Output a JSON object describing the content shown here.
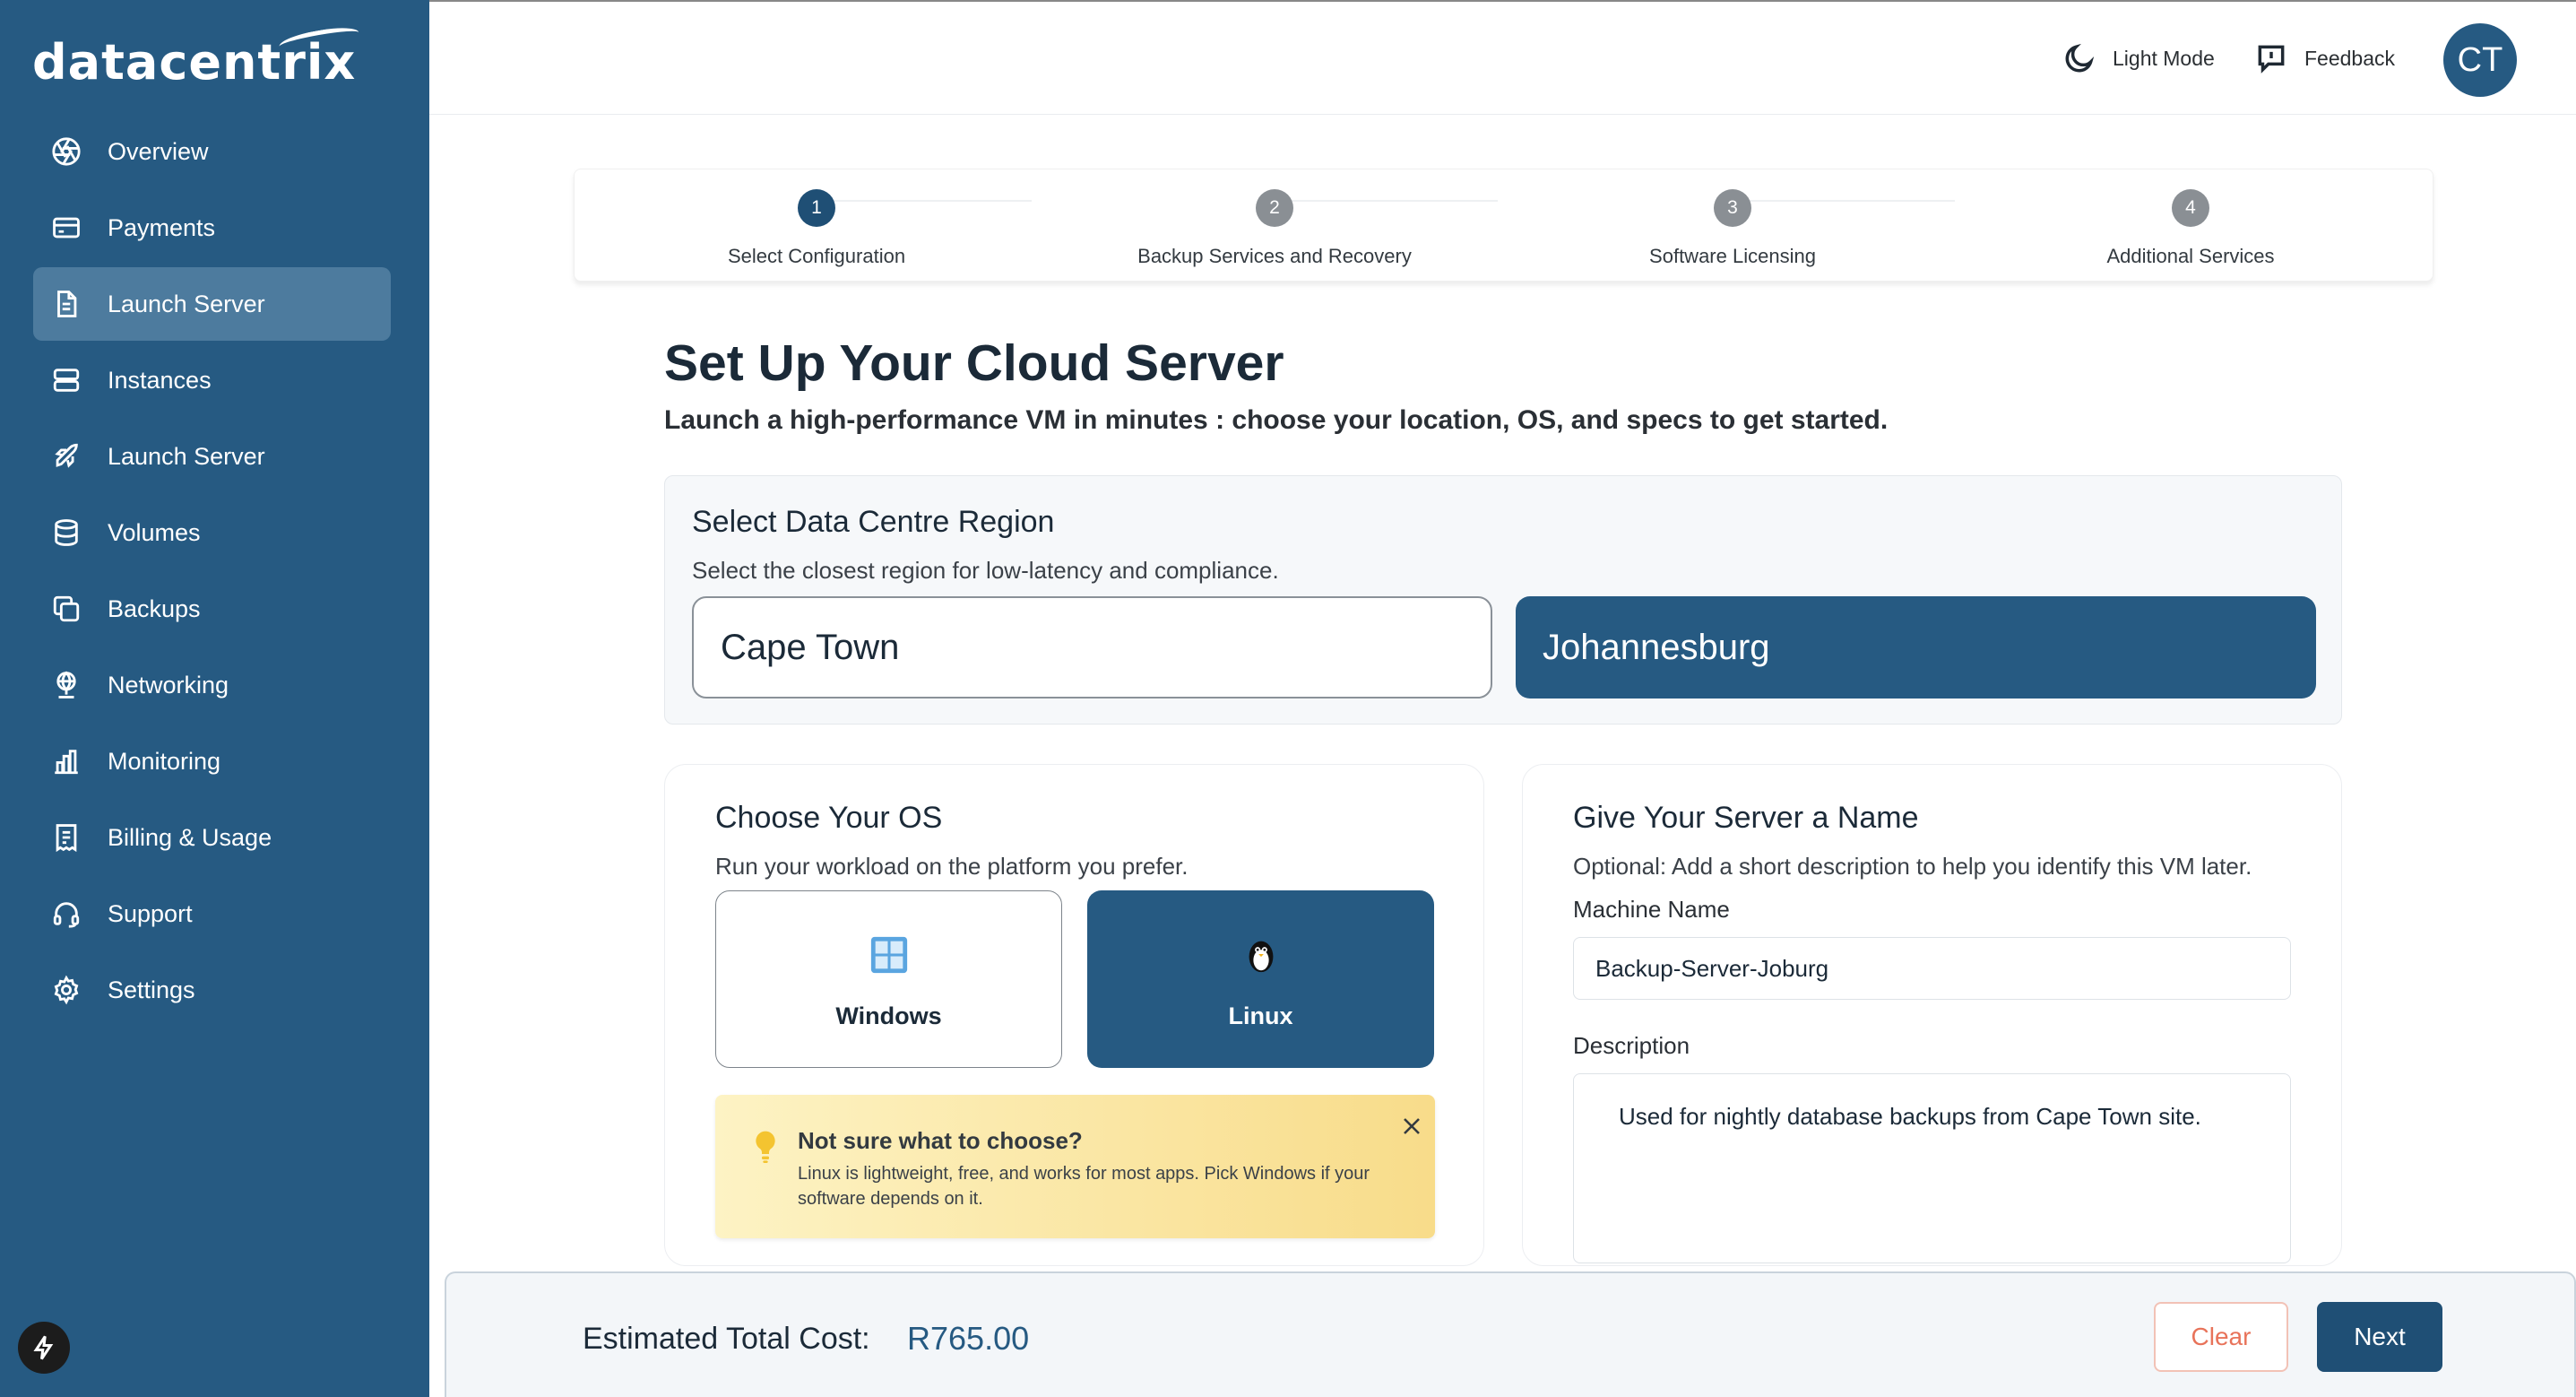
{
  "brand": {
    "name": "datacentrix"
  },
  "sidebar": {
    "items": [
      {
        "label": "Overview",
        "icon": "aperture-icon",
        "active": false
      },
      {
        "label": "Payments",
        "icon": "credit-card-icon",
        "active": false
      },
      {
        "label": "Launch Server",
        "icon": "document-icon",
        "active": true
      },
      {
        "label": "Instances",
        "icon": "server-icon",
        "active": false
      },
      {
        "label": "Launch Server",
        "icon": "rocket-icon",
        "active": false
      },
      {
        "label": "Volumes",
        "icon": "database-icon",
        "active": false
      },
      {
        "label": "Backups",
        "icon": "copy-icon",
        "active": false
      },
      {
        "label": "Networking",
        "icon": "globe-network-icon",
        "active": false
      },
      {
        "label": "Monitoring",
        "icon": "bar-chart-icon",
        "active": false
      },
      {
        "label": "Billing & Usage",
        "icon": "receipt-icon",
        "active": false
      },
      {
        "label": "Support",
        "icon": "headset-icon",
        "active": false
      },
      {
        "label": "Settings",
        "icon": "gear-icon",
        "active": false
      }
    ]
  },
  "header": {
    "light_mode_label": "Light Mode",
    "feedback_label": "Feedback",
    "avatar_initials": "CT"
  },
  "stepper": {
    "steps": [
      {
        "number": "1",
        "label": "Select Configuration",
        "active": true
      },
      {
        "number": "2",
        "label": "Backup Services and Recovery",
        "active": false
      },
      {
        "number": "3",
        "label": "Software Licensing",
        "active": false
      },
      {
        "number": "4",
        "label": "Additional Services",
        "active": false
      }
    ]
  },
  "page": {
    "title": "Set Up Your Cloud Server",
    "subtitle": "Launch a high-performance VM in minutes : choose your location, OS, and specs to get started."
  },
  "region": {
    "title": "Select Data Centre Region",
    "subtitle": "Select the closest region for low-latency and compliance.",
    "options": [
      "Cape Town",
      "Johannesburg"
    ],
    "selected": "Johannesburg"
  },
  "os": {
    "title": "Choose Your OS",
    "subtitle": "Run your workload on the platform you prefer.",
    "options": [
      "Windows",
      "Linux"
    ],
    "selected": "Linux",
    "tip": {
      "title": "Not sure what to choose?",
      "body": "Linux is lightweight, free, and works for most apps. Pick Windows if your software depends on it."
    }
  },
  "server_name": {
    "title": "Give Your Server a Name",
    "subtitle": "Optional: Add a short description to help you identify this VM later.",
    "machine_name_label": "Machine Name",
    "machine_name_value": "Backup-Server-Joburg",
    "description_label": "Description",
    "description_value": "Used for nightly database backups from Cape Town site."
  },
  "footer": {
    "cost_label": "Estimated Total Cost:",
    "cost_value": "R765.00",
    "clear_label": "Clear",
    "next_label": "Next"
  },
  "colors": {
    "primary": "#265a82",
    "primary_dark": "#1f4f75",
    "clear_text": "#e8735a"
  }
}
